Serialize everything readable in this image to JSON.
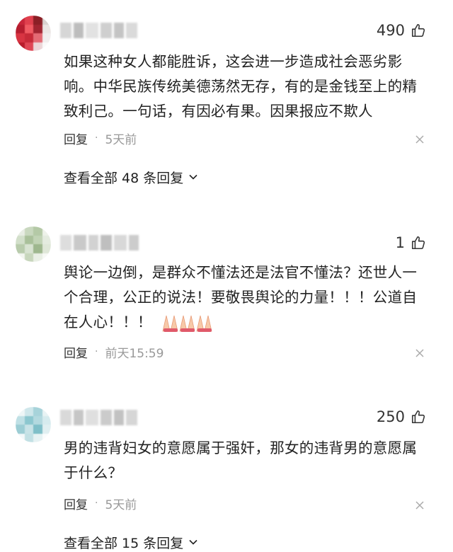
{
  "comments": [
    {
      "likes": "490",
      "text": "如果这种女人都能胜诉，这会进一步造成社会恶劣影响。中华民族传统美德荡然无存，有的是金钱至上的精致利己。一句话，有因必有果。因果报应不欺人",
      "reply_label": "回复",
      "separator": "·",
      "time": "5天前",
      "view_replies": "查看全部 48 条回复"
    },
    {
      "likes": "1",
      "text": "舆论一边倒，是群众不懂法还是法官不懂法？还世人一个合理，公正的说法！要敬畏舆论的力量！！！公道自在人心！！！",
      "emoji": "praying-hands-emoji",
      "reply_label": "回复",
      "separator": "·",
      "time": "前天15:59"
    },
    {
      "likes": "250",
      "text": "男的违背妇女的意愿属于强奸，那女的违背男的意愿属于什么？",
      "reply_label": "回复",
      "separator": "·",
      "time": "5天前",
      "view_replies": "查看全部 15 条回复"
    }
  ],
  "icons": {
    "like": "thumbs-up-icon",
    "close": "close-icon",
    "expand": "chevron-down-icon"
  },
  "colors": {
    "text": "#222222",
    "muted": "#999999",
    "background": "#ffffff"
  }
}
